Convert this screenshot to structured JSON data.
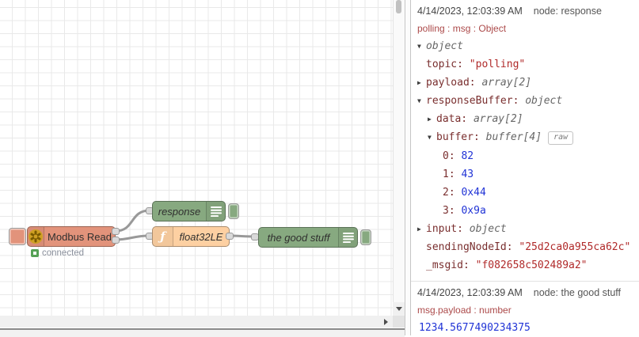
{
  "colors": {
    "modbus": "#e2937b",
    "function": "#fdd0a2",
    "debug": "#87a980",
    "status": "#56a156",
    "wire": "#999999"
  },
  "flow": {
    "nodes": {
      "modbus": {
        "label": "Modbus Read",
        "status": "connected"
      },
      "response": {
        "label": "response"
      },
      "func": {
        "label": "float32LE",
        "icon": "ƒ"
      },
      "goodstuff": {
        "label": "the good stuff"
      }
    }
  },
  "debug": {
    "messages": [
      {
        "timestamp": "4/14/2023, 12:03:39 AM",
        "node": "node: response",
        "meta": "polling : msg : Object",
        "tree": [
          {
            "level": 0,
            "arrow": "open",
            "key": "",
            "value": "object",
            "type": "meta"
          },
          {
            "level": 1,
            "arrow": "",
            "key": "topic",
            "value": "\"polling\"",
            "type": "string"
          },
          {
            "level": 1,
            "arrow": "closed",
            "key": "payload",
            "value": "array[2]",
            "type": "meta"
          },
          {
            "level": 1,
            "arrow": "open",
            "key": "responseBuffer",
            "value": "object",
            "type": "meta"
          },
          {
            "level": 2,
            "arrow": "closed",
            "key": "data",
            "value": "array[2]",
            "type": "meta"
          },
          {
            "level": 2,
            "arrow": "open",
            "key": "buffer",
            "value": "buffer[4]",
            "type": "meta",
            "button": "raw"
          },
          {
            "level": 3,
            "arrow": "",
            "key": "0",
            "value": "82",
            "type": "number"
          },
          {
            "level": 3,
            "arrow": "",
            "key": "1",
            "value": "43",
            "type": "number"
          },
          {
            "level": 3,
            "arrow": "",
            "key": "2",
            "value": "0x44",
            "type": "number"
          },
          {
            "level": 3,
            "arrow": "",
            "key": "3",
            "value": "0x9a",
            "type": "number"
          },
          {
            "level": 1,
            "arrow": "closed",
            "key": "input",
            "value": "object",
            "type": "meta"
          },
          {
            "level": 1,
            "arrow": "",
            "key": "sendingNodeId",
            "value": "\"25d2ca0a955ca62c\"",
            "type": "string"
          },
          {
            "level": 1,
            "arrow": "",
            "key": "_msgid",
            "value": "\"f082658c502489a2\"",
            "type": "string"
          }
        ]
      },
      {
        "timestamp": "4/14/2023, 12:03:39 AM",
        "node": "node: the good stuff",
        "meta": "msg.payload : number",
        "payload": "1234.5677490234375"
      }
    ]
  }
}
